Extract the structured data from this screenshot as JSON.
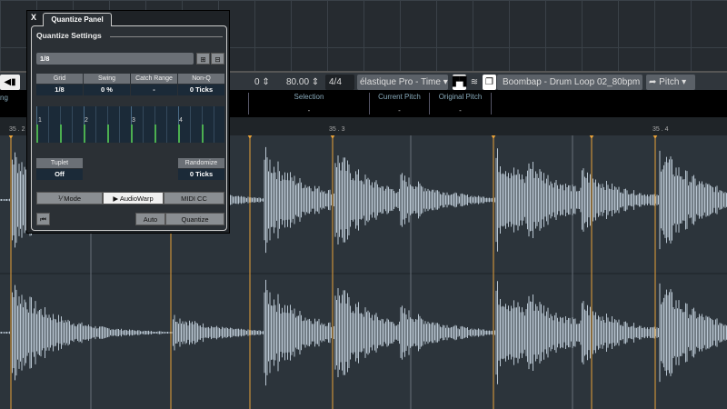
{
  "toolbar": {
    "value_zero": "0",
    "tempo": "80.00",
    "signature": "4/4",
    "algorithm": "élastique Pro - Time",
    "clip_name": "Boombap - Drum Loop 02_80bpm",
    "pitch_button": "Pitch",
    "left_label": "ng"
  },
  "info": {
    "selection_label": "Selection",
    "selection_value": "-",
    "current_pitch_label": "Current Pitch",
    "current_pitch_value": "-",
    "original_pitch_label": "Original Pitch",
    "original_pitch_value": "-"
  },
  "ruler": {
    "marks": [
      "35 . 2",
      "35 . 3",
      "35 . 4"
    ]
  },
  "panel": {
    "close": "X",
    "tab": "Quantize Panel",
    "title": "Quantize Settings",
    "preset": "1/8",
    "grid_label": "Grid",
    "grid_value": "1/8",
    "swing_label": "Swing",
    "swing_value": "0 %",
    "catch_label": "Catch Range",
    "catch_value": "-",
    "nonq_label": "Non-Q",
    "nonq_value": "0 Ticks",
    "beats": [
      "1",
      "2",
      "3",
      "4"
    ],
    "tuplet_label": "Tuplet",
    "tuplet_value": "Off",
    "randomize_label": "Randomize",
    "randomize_value": "0 Ticks",
    "mode": "Mode",
    "audiowarp": "AudioWarp",
    "midicc": "MIDI CC",
    "auto": "Auto",
    "quantize": "Quantize"
  },
  "colors": {
    "warp_marker": "#e8a23a",
    "waveform": "#b9c6d2",
    "grid_green": "#4caf50"
  }
}
